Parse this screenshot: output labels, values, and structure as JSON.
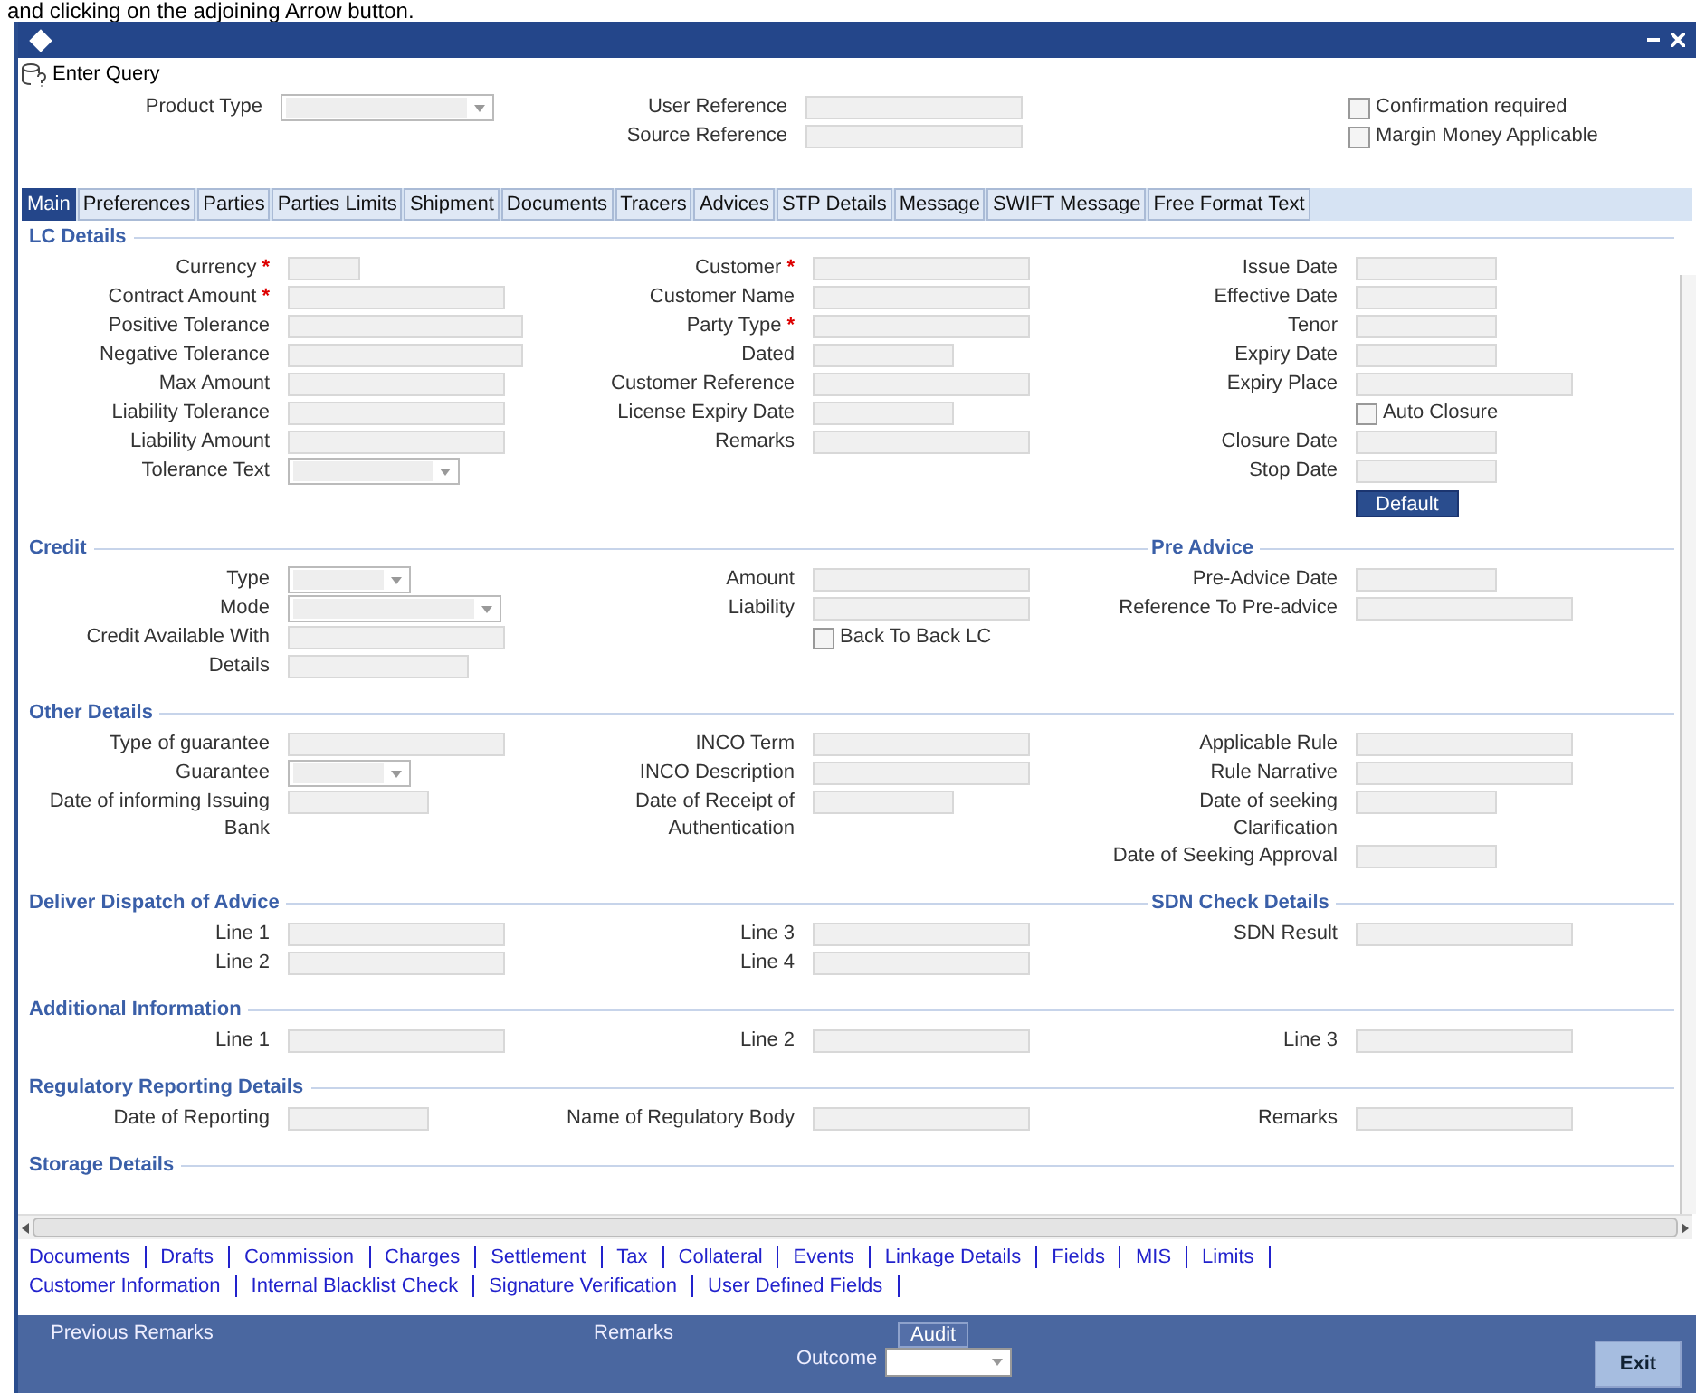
{
  "caption": "and clicking on the adjoining Arrow button.",
  "toolbar": {
    "label": "Enter Query"
  },
  "header": {
    "columns": [
      [
        {
          "label": "Product Type",
          "kind": "select-wide"
        }
      ],
      [
        {
          "label": "User Reference",
          "kind": "text"
        },
        {
          "label": "Source Reference",
          "kind": "text"
        }
      ],
      [
        {
          "label": "Confirmation required",
          "kind": "checkbox",
          "checked": false
        },
        {
          "label": "Margin Money Applicable",
          "kind": "checkbox",
          "checked": false
        }
      ]
    ]
  },
  "tabs": [
    {
      "label": "Main",
      "selected": true
    },
    {
      "label": "Preferences",
      "selected": false
    },
    {
      "label": "Parties",
      "selected": false
    },
    {
      "label": "Parties Limits",
      "selected": false
    },
    {
      "label": "Shipment",
      "selected": false
    },
    {
      "label": "Documents",
      "selected": false
    },
    {
      "label": "Tracers",
      "selected": false
    },
    {
      "label": "Advices",
      "selected": false
    },
    {
      "label": "STP Details",
      "selected": false
    },
    {
      "label": "Message",
      "selected": false
    },
    {
      "label": "SWIFT Message",
      "selected": false
    },
    {
      "label": "Free Format Text",
      "selected": false
    }
  ],
  "sections": [
    {
      "title": "LC Details",
      "columns": [
        [
          {
            "label": "Currency",
            "kind": "short",
            "marker": "*"
          },
          {
            "label": "Contract Amount",
            "kind": "text",
            "marker": "*"
          },
          {
            "label": "Positive Tolerance",
            "kind": "wide"
          },
          {
            "label": "Negative Tolerance",
            "kind": "wide"
          },
          {
            "label": "Max Amount",
            "kind": "text"
          },
          {
            "label": "Liability Tolerance",
            "kind": "text"
          },
          {
            "label": "Liability Amount",
            "kind": "text"
          },
          {
            "label": "Tolerance Text",
            "kind": "select"
          }
        ],
        [
          {
            "label": "Customer",
            "kind": "text",
            "marker": "*"
          },
          {
            "label": "Customer Name",
            "kind": "text"
          },
          {
            "label": "Party Type",
            "kind": "text",
            "marker": "*"
          },
          {
            "label": "Dated",
            "kind": "date"
          },
          {
            "label": "Customer Reference",
            "kind": "text"
          },
          {
            "label": "License Expiry Date",
            "kind": "date"
          },
          {
            "label": "Remarks",
            "kind": "text"
          }
        ],
        [
          {
            "label": "Issue Date",
            "kind": "date"
          },
          {
            "label": "Effective Date",
            "kind": "date"
          },
          {
            "label": "Tenor",
            "kind": "date"
          },
          {
            "label": "Expiry Date",
            "kind": "date"
          },
          {
            "label": "Expiry Place",
            "kind": "text"
          },
          {
            "label": "Auto Closure",
            "kind": "checkbox",
            "checked": false
          },
          {
            "label": "Closure Date",
            "kind": "date"
          },
          {
            "label": "Stop Date",
            "kind": "date"
          },
          {
            "label": "Default",
            "kind": "button"
          }
        ]
      ]
    },
    {
      "title": "Credit",
      "side_title": "Pre Advice",
      "columns": [
        [
          {
            "label": "Type",
            "kind": "select-narrow"
          },
          {
            "label": "Mode",
            "kind": "select-wide"
          },
          {
            "label": "Credit Available With",
            "kind": "text"
          },
          {
            "label": "Details",
            "kind": "medium"
          }
        ],
        [
          {
            "label": "Amount",
            "kind": "text"
          },
          {
            "label": "Liability",
            "kind": "text"
          },
          {
            "label": "Back To Back LC",
            "kind": "checkbox",
            "checked": false
          }
        ],
        [
          {
            "label": "Pre-Advice Date",
            "kind": "date"
          },
          {
            "label": "Reference To Pre-advice",
            "kind": "text"
          }
        ]
      ]
    },
    {
      "title": "Other Details",
      "columns": [
        [
          {
            "label": "Type of guarantee",
            "kind": "text"
          },
          {
            "label": "Guarantee",
            "kind": "select-narrow"
          },
          {
            "label": "Date of informing Issuing Bank",
            "kind": "date"
          }
        ],
        [
          {
            "label": "INCO Term",
            "kind": "text"
          },
          {
            "label": "INCO Description",
            "kind": "text"
          },
          {
            "label": "Date of Receipt of Authentication",
            "kind": "date"
          }
        ],
        [
          {
            "label": "Applicable Rule",
            "kind": "text"
          },
          {
            "label": "Rule Narrative",
            "kind": "text"
          },
          {
            "label": "Date of seeking Clarification",
            "kind": "date"
          },
          {
            "label": "Date of Seeking Approval",
            "kind": "date"
          }
        ]
      ]
    },
    {
      "title": "Deliver Dispatch of Advice",
      "side_title": "SDN Check Details",
      "columns": [
        [
          {
            "label": "Line 1",
            "kind": "text"
          },
          {
            "label": "Line 2",
            "kind": "text"
          }
        ],
        [
          {
            "label": "Line 3",
            "kind": "text"
          },
          {
            "label": "Line 4",
            "kind": "text"
          }
        ],
        [
          {
            "label": "SDN Result",
            "kind": "text"
          }
        ]
      ]
    },
    {
      "title": "Additional Information",
      "columns": [
        [
          {
            "label": "Line 1",
            "kind": "text"
          }
        ],
        [
          {
            "label": "Line 2",
            "kind": "text"
          }
        ],
        [
          {
            "label": "Line 3",
            "kind": "text"
          }
        ]
      ]
    },
    {
      "title": "Regulatory Reporting Details",
      "columns": [
        [
          {
            "label": "Date of Reporting",
            "kind": "date"
          }
        ],
        [
          {
            "label": "Name of Regulatory Body",
            "kind": "text"
          }
        ],
        [
          {
            "label": "Remarks",
            "kind": "text"
          }
        ]
      ]
    },
    {
      "title": "Storage Details"
    }
  ],
  "links": [
    [
      "Documents",
      "Drafts",
      "Commission",
      "Charges",
      "Settlement",
      "Tax",
      "Collateral",
      "Events",
      "Linkage Details",
      "Fields",
      "MIS",
      "Limits"
    ],
    [
      "Customer Information",
      "Internal Blacklist Check",
      "Signature Verification",
      "User Defined Fields"
    ]
  ],
  "footer": {
    "previous_remarks": "Previous Remarks",
    "remarks": "Remarks",
    "audit": "Audit",
    "outcome_label": "Outcome",
    "exit": "Exit"
  }
}
